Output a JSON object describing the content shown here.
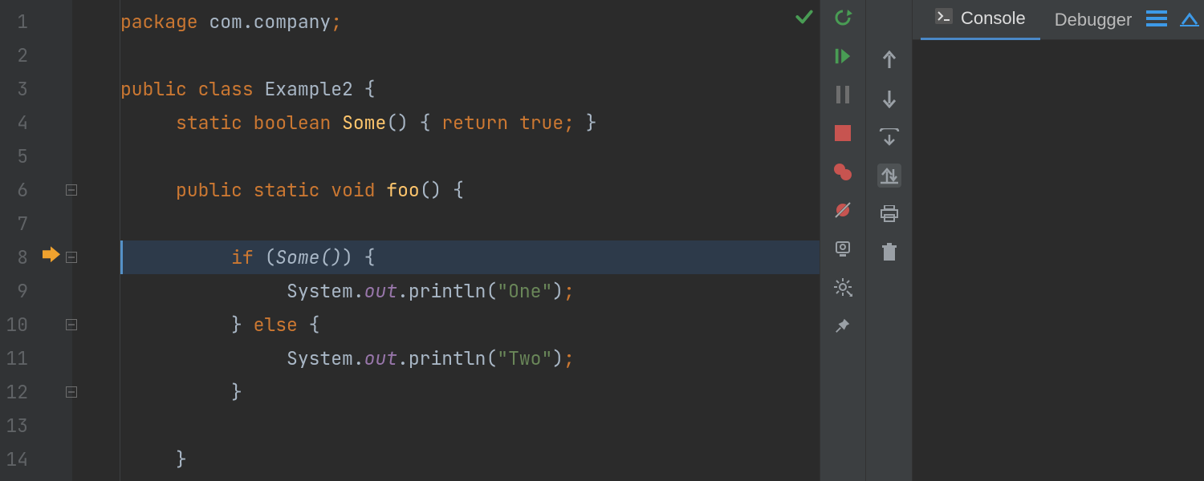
{
  "editor": {
    "lines": [
      {
        "num": "1",
        "fold": false,
        "arrow": false
      },
      {
        "num": "2",
        "fold": false,
        "arrow": false
      },
      {
        "num": "3",
        "fold": false,
        "arrow": false
      },
      {
        "num": "4",
        "fold": false,
        "arrow": false
      },
      {
        "num": "5",
        "fold": false,
        "arrow": false
      },
      {
        "num": "6",
        "fold": true,
        "arrow": false
      },
      {
        "num": "7",
        "fold": false,
        "arrow": false
      },
      {
        "num": "8",
        "fold": true,
        "arrow": true
      },
      {
        "num": "9",
        "fold": false,
        "arrow": false
      },
      {
        "num": "10",
        "fold": true,
        "arrow": false
      },
      {
        "num": "11",
        "fold": false,
        "arrow": false
      },
      {
        "num": "12",
        "fold": true,
        "arrow": false
      },
      {
        "num": "13",
        "fold": false,
        "arrow": false
      },
      {
        "num": "14",
        "fold": false,
        "arrow": false
      }
    ],
    "code": {
      "l1": {
        "kw1": "package",
        "space": " ",
        "id": "com.company",
        "semi": ";"
      },
      "l3": {
        "kw1": "public",
        "kw2": "class",
        "cls": "Example2",
        "brace": "{"
      },
      "l4": {
        "kw1": "static",
        "kw2": "boolean",
        "mth": "Some",
        "parens": "()",
        "brace1": "{",
        "kw3": "return",
        "kw4": "true",
        "semi": ";",
        "brace2": "}"
      },
      "l6": {
        "kw1": "public",
        "kw2": "static",
        "kw3": "void",
        "mth": "foo",
        "parens": "()",
        "brace": "{"
      },
      "l8": {
        "kw1": "if",
        "open": "(",
        "call": "Some",
        "callp": "()",
        ")": ")",
        "brace": "{"
      },
      "l9": {
        "sys": "System",
        "dot1": ".",
        "out": "out",
        "dot2": ".",
        "println": "println",
        "open": "(",
        "str": "\"One\"",
        "close": ")",
        "semi": ";"
      },
      "l10": {
        "brace": "}",
        "kw": "else",
        "brace2": "{"
      },
      "l11": {
        "sys": "System",
        "dot1": ".",
        "out": "out",
        "dot2": ".",
        "println": "println",
        "open": "(",
        "str": "\"Two\"",
        "close": ")",
        "semi": ";"
      },
      "l12": {
        "brace": "}"
      },
      "l14": {
        "brace": "}"
      }
    }
  },
  "tabs": {
    "console": "Console",
    "debugger": "Debugger"
  }
}
